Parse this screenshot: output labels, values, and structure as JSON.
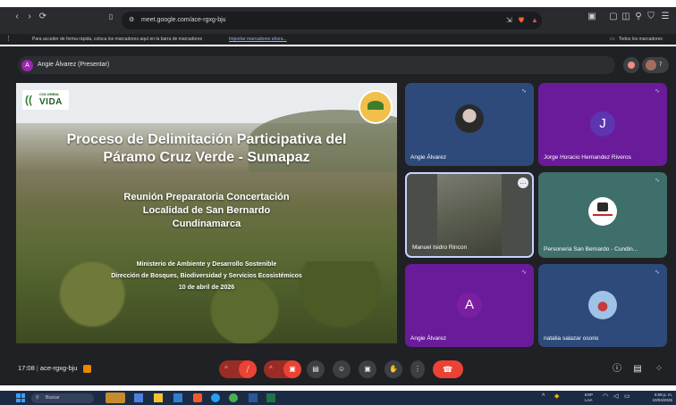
{
  "browser": {
    "url": "meet.google.com/ace-rgxg-bju",
    "bookmarks_text": "Para acceder de forma rápida, coloca los marcadores aquí en la barra de marcadores",
    "bookmarks_link": "Importar marcadores ahora...",
    "all_bookmarks": "Todos los marcadores"
  },
  "meet": {
    "presenter_initial": "A",
    "presenter_label": "Angie Álvarez (Presentar)",
    "participants_count": "7",
    "time": "17:08",
    "meeting_code": "ace-rgxg-bju"
  },
  "slide": {
    "logo_top": "COLOMBIA",
    "logo_main": "VIDA",
    "title_line1": "Proceso de Delimitación Participativa del",
    "title_line2": "Páramo Cruz Verde - Sumapaz",
    "sub_line1": "Reunión Preparatoria Concertación",
    "sub_line2": "Localidad de San Bernardo",
    "sub_line3": "Cundinamarca",
    "small_line1": "Ministerio de Ambiente y Desarrollo Sostenible",
    "small_line2": "Dirección de Bosques, Biodiversidad y Servicios Ecosistémicos",
    "small_line3": "10 de abril de 2026"
  },
  "tiles": [
    {
      "name": "Angie Álvarez"
    },
    {
      "name": "Jorge Horacio Hernandez Riveros",
      "initial": "J"
    },
    {
      "name": "Manuel Isidro Rincon"
    },
    {
      "name": "Personeria San Bernardo - Cundin..."
    },
    {
      "name": "Angie Álvarez",
      "initial": "A"
    },
    {
      "name": "natalia salazar osorio"
    }
  ],
  "taskbar": {
    "search": "Buscar",
    "lang1": "ESP",
    "lang2": "LAA",
    "clock_time": "5:08 p. m.",
    "clock_date": "10/04/2026"
  },
  "colors": {
    "meet_bg": "#202124",
    "tile_purple": "#6a1b9a",
    "tile_teal": "#3f6f6a",
    "tile_blue": "#2d4a7a",
    "end_call_red": "#ea4335",
    "muted_red": "#9b2c25"
  }
}
